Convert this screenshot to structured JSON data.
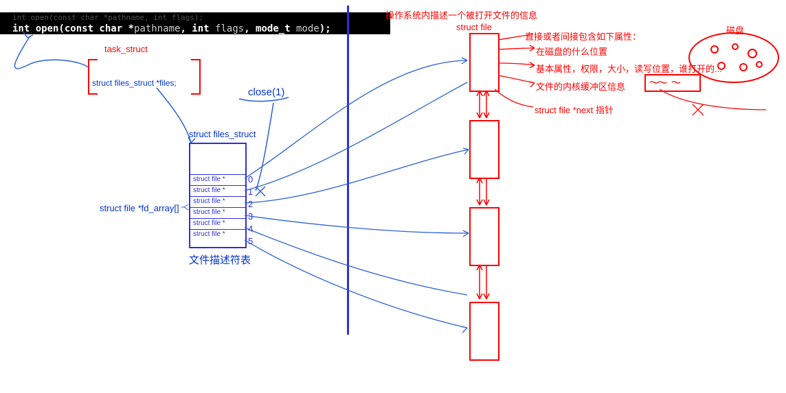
{
  "code": {
    "line1_dim": "int open(const char *pathname, int flags);",
    "line2_prefix": "int open(const char *",
    "line2_pathname": "pathname",
    "line2_mid": ", int ",
    "line2_flags": "flags",
    "line2_mid2": ", mode_t ",
    "line2_mode": "mode",
    "line2_end": ");"
  },
  "labels": {
    "task_struct": "task_struct",
    "files_member": "struct files_struct *files;",
    "close1": "close(1)",
    "files_struct": "struct files_struct",
    "fd_array": "struct file *fd_array[]",
    "fd_table_cn": "文件描述符表",
    "cell": "struct file *",
    "idx0": "0",
    "idx1": "1",
    "idx2": "2",
    "idx3": "3",
    "idx4": "4",
    "idx5": "5",
    "top_cn": "操作系统内描述一个被打开文件的信息",
    "struct_file": "struct file",
    "attr_head": "直接或者间接包含如下属性：",
    "attr1": "在磁盘的什么位置",
    "attr2": "基本属性，权限，大小，读写位置，谁打开的...",
    "attr3": "文件的内核缓冲区信息",
    "next_ptr": "struct file *next 指针",
    "disk": "磁盘",
    "small_box_label": ""
  }
}
